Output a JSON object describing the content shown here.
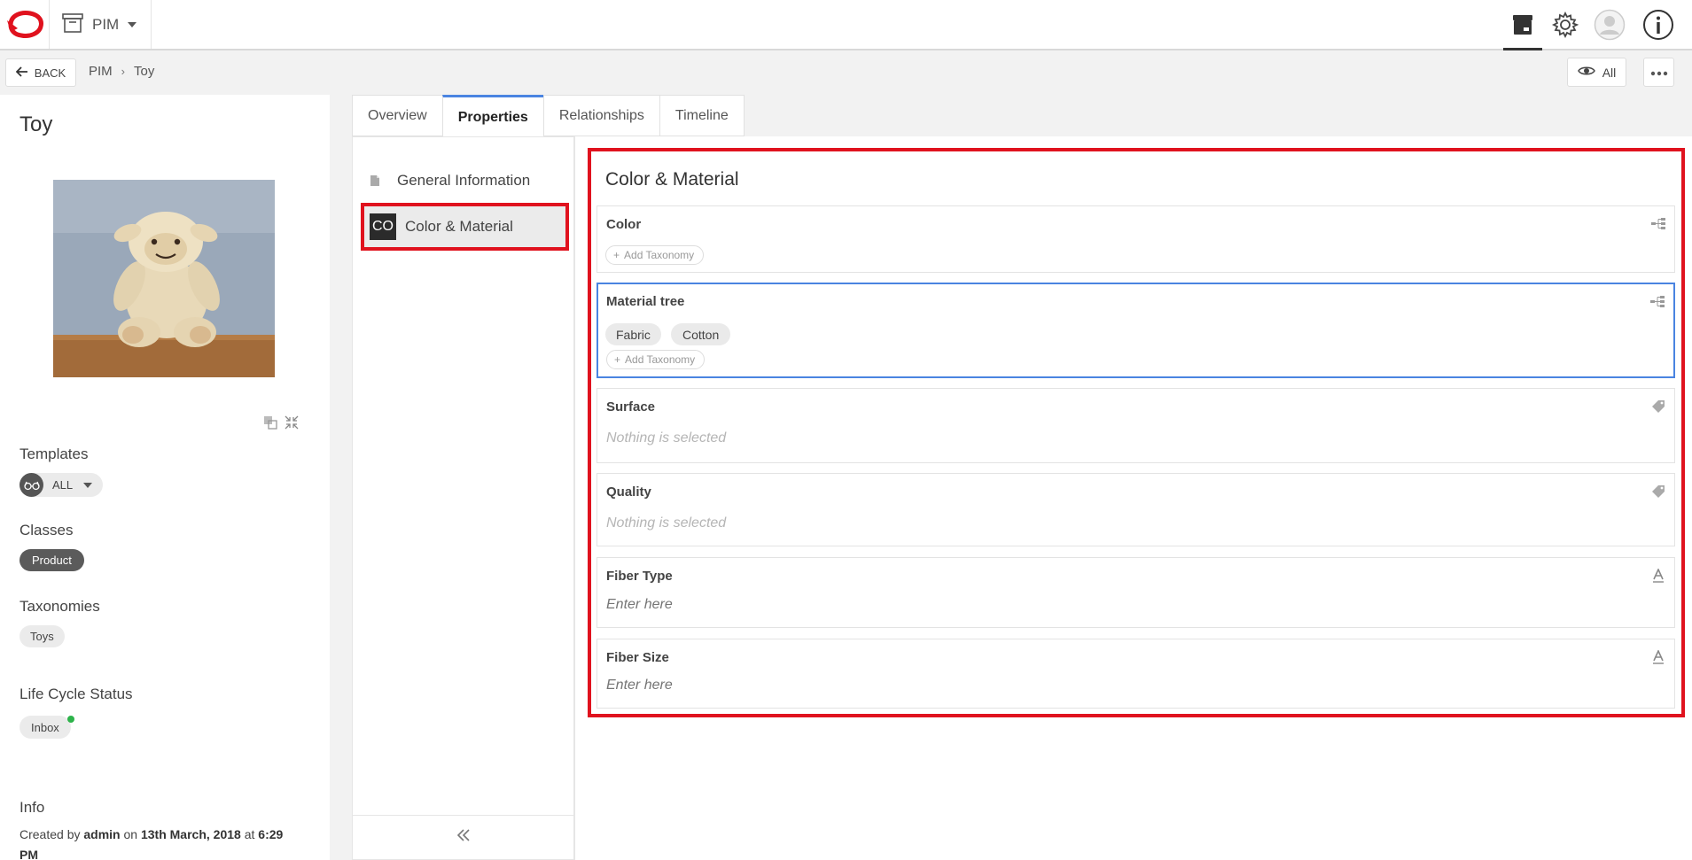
{
  "app": {
    "switcher_label": "PIM"
  },
  "toolbar": {
    "back_label": "BACK",
    "breadcrumb": [
      "PIM",
      "Toy"
    ],
    "view_label": "All"
  },
  "product": {
    "title": "Toy",
    "templates_label": "Templates",
    "template_value": "ALL",
    "classes_label": "Classes",
    "class_value": "Product",
    "taxonomies_label": "Taxonomies",
    "taxonomy_value": "Toys",
    "lifecycle_label": "Life Cycle Status",
    "lifecycle_value": "Inbox",
    "info_label": "Info",
    "info": {
      "created_by_prefix": "Created by",
      "user": "admin",
      "on": "on",
      "date": "13th March, 2018",
      "at": "at",
      "time": "6:29 PM"
    }
  },
  "tabs": [
    {
      "label": "Overview"
    },
    {
      "label": "Properties",
      "active": true
    },
    {
      "label": "Relationships"
    },
    {
      "label": "Timeline"
    }
  ],
  "sections": [
    {
      "label": "General Information"
    },
    {
      "badge": "CO",
      "label": "Color & Material",
      "active": true
    }
  ],
  "section_title": "Color & Material",
  "fields": {
    "color": {
      "label": "Color",
      "add_label": "Add Taxonomy",
      "icon": "taxonomy-tree-icon"
    },
    "material": {
      "label": "Material tree",
      "tags": [
        "Fabric",
        "Cotton"
      ],
      "add_label": "Add Taxonomy",
      "icon": "taxonomy-tree-icon"
    },
    "surface": {
      "label": "Surface",
      "placeholder": "Nothing is selected",
      "icon": "tag-icon"
    },
    "quality": {
      "label": "Quality",
      "placeholder": "Nothing is selected",
      "icon": "tag-icon"
    },
    "fiber_type": {
      "label": "Fiber Type",
      "placeholder": "Enter here",
      "icon": "text-icon"
    },
    "fiber_size": {
      "label": "Fiber Size",
      "placeholder": "Enter here",
      "icon": "text-icon"
    }
  },
  "colors": {
    "accent_blue": "#4a84e1",
    "highlight_red": "#e0121e",
    "logo_red": "#e0121e",
    "status_green": "#2db34a"
  }
}
